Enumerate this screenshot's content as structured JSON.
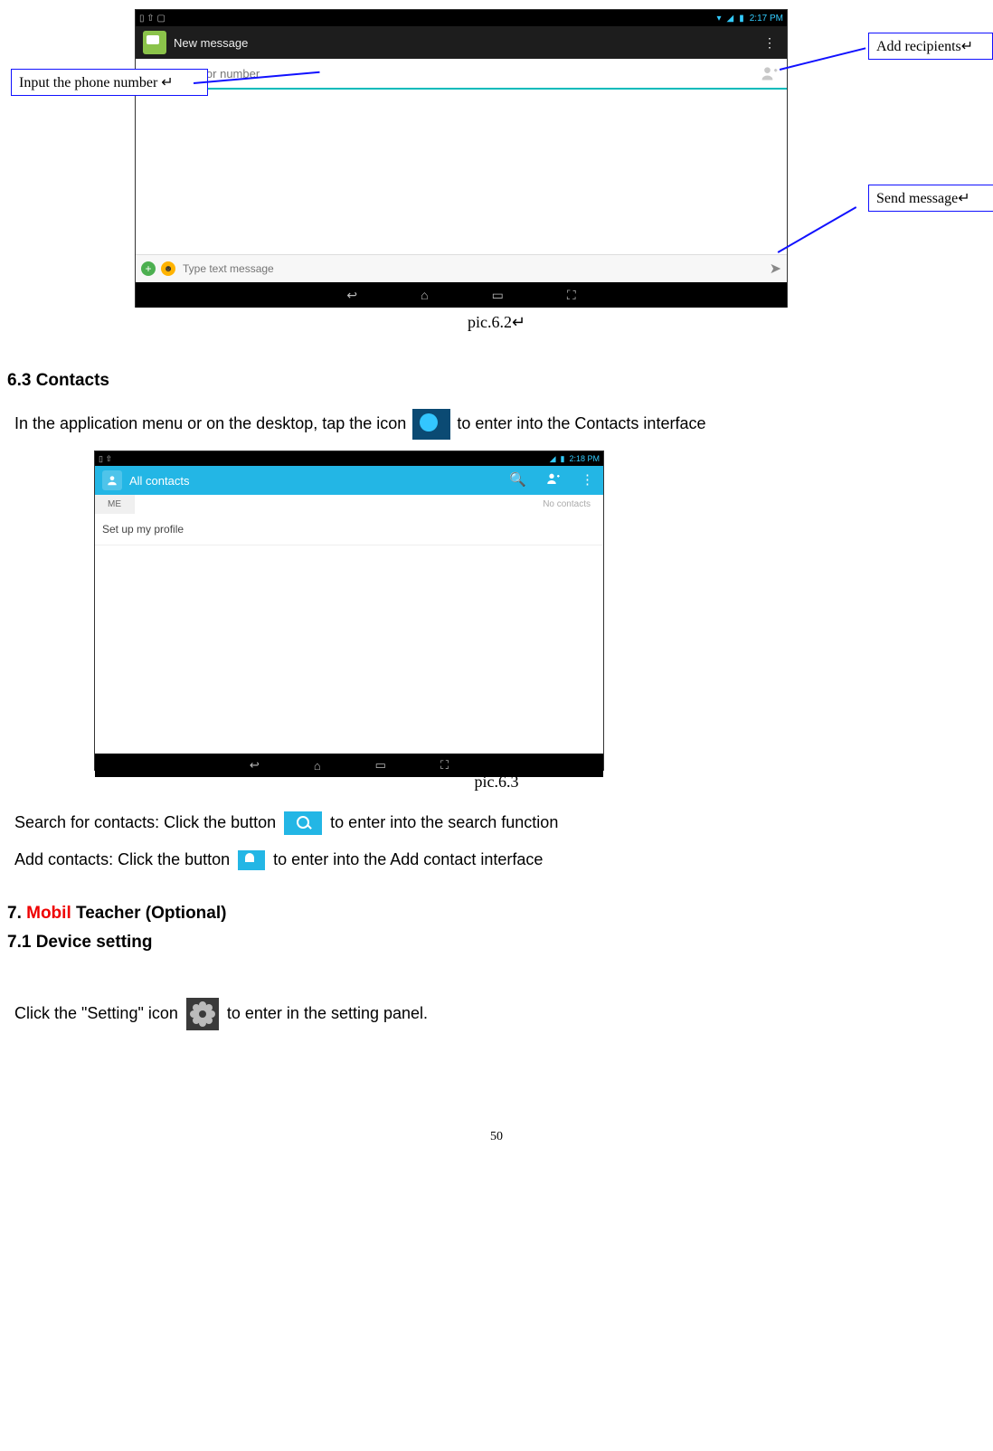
{
  "shot1": {
    "status_right": "2:17 PM",
    "header_title": "New message",
    "recipient_placeholder": "Type name or number",
    "compose_placeholder": "Type text message"
  },
  "callouts": {
    "input_phone": "Input the phone number  ↵",
    "add_recipients": "Add recipients↵",
    "send_message": "Send message↵"
  },
  "pic62_caption": "pic.6.2↵",
  "section_63_title": "6.3 Contacts",
  "para_63": {
    "pre": "In the application menu or on the desktop, tap the icon ",
    "post": "to enter into the Contacts interface"
  },
  "shot2": {
    "status_right": "2:18 PM",
    "header_title": "All contacts",
    "tab_me": "ME",
    "tab_nocontacts": "No contacts",
    "profile_setup": "Set up my profile"
  },
  "pic63_caption": "pic.6.3",
  "search_line": {
    "pre": "Search for contacts: Click the button ",
    "post": " to enter into the search function"
  },
  "add_line": {
    "pre": "Add contacts: Click the button",
    "post": " to enter into the Add contact interface"
  },
  "section_7_prefix": "7. ",
  "section_7_mobil": "Mobil",
  "section_7_suffix": " Teacher (Optional)",
  "section_71_title": "7.1 Device setting",
  "setting_line": {
    "pre": "Click the \"Setting\" icon ",
    "post": " to enter in the setting panel."
  },
  "page_number": "50"
}
